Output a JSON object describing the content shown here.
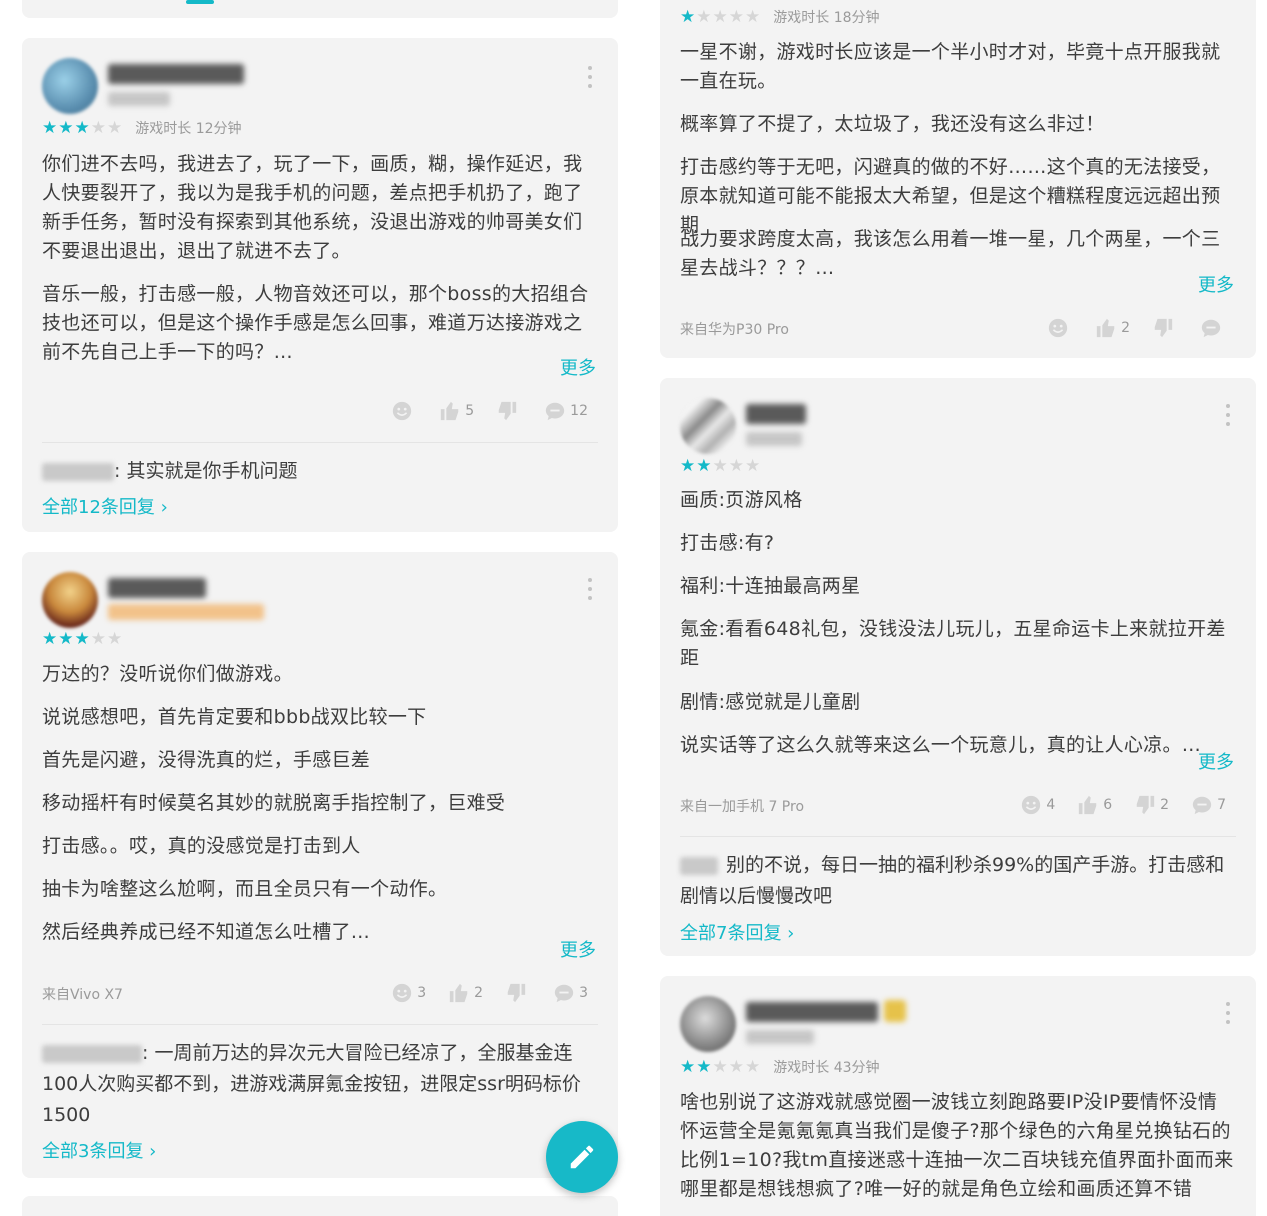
{
  "review1": {
    "rating": 3,
    "playtime": "游戏时长 12分钟",
    "paragraphs": [
      "你们进不去吗，我进去了，玩了一下，画质，糊，操作延迟，我人快要裂开了，我以为是我手机的问题，差点把手机扔了，跑了新手任务，暂时没有探索到其他系统，没退出游戏的帅哥美女们不要退出退出，退出了就进不去了。",
      "音乐一般，打击感一般，人物音效还可以，那个boss的大招组合技也还可以，但是这个操作手感是怎么回事，难道万达接游戏之前不先自己上手一下的吗？…"
    ],
    "more": "更多",
    "likes": "5",
    "comments": "12",
    "reply_text": ": 其实就是你手机问题",
    "all_replies": "全部12条回复 ›"
  },
  "review2": {
    "rating": 3,
    "paragraphs": [
      "万达的？没听说你们做游戏。",
      "说说感想吧，首先肯定要和bbb战双比较一下",
      "首先是闪避，没得洗真的烂，手感巨差",
      "移动摇杆有时候莫名其妙的就脱离手指控制了，巨难受",
      "打击感。。哎，真的没感觉是打击到人",
      "抽卡为啥整这么尬啊，而且全员只有一个动作。",
      "然后经典养成已经不知道怎么吐槽了…"
    ],
    "more": "更多",
    "device": "来自Vivo X7",
    "funny": "3",
    "likes": "2",
    "comments": "3",
    "reply_text": ": 一周前万达的异次元大冒险已经凉了，全服基金连100人次购买都不到，进游戏满屏氪金按钮，进限定ssr明码标价1500",
    "all_replies": "全部3条回复 ›"
  },
  "review3": {
    "rating": 1,
    "playtime": "游戏时长 18分钟",
    "paragraphs": [
      "一星不谢，游戏时长应该是一个半小时才对，毕竟十点开服我就一直在玩。",
      "概率算了不提了，太垃圾了，我还没有这么非过！",
      "打击感约等于无吧，闪避真的做的不好……这个真的无法接受，原本就知道可能不能报太大希望，但是这个糟糕程度远远超出预期",
      "战力要求跨度太高，我该怎么用着一堆一星，几个两星，一个三星去战斗？？？…"
    ],
    "more": "更多",
    "device": "来自华为P30 Pro",
    "likes": "2"
  },
  "review4": {
    "rating": 2,
    "paragraphs": [
      "画质:页游风格",
      "打击感:有?",
      "福利:十连抽最高两星",
      "氪金:看看648礼包，没钱没法儿玩儿，五星命运卡上来就拉开差距",
      "剧情:感觉就是儿童剧",
      "说实话等了这么久就等来这么一个玩意儿，真的让人心凉。…"
    ],
    "more": "更多",
    "device": "来自一加手机 7 Pro",
    "funny": "4",
    "likes": "6",
    "dislikes": "2",
    "comments": "7",
    "reply_text": "别的不说，每日一抽的福利秒杀99%的国产手游。打击感和剧情以后慢慢改吧",
    "all_replies": "全部7条回复 ›"
  },
  "review5": {
    "rating": 2,
    "playtime": "游戏时长 43分钟",
    "paragraphs": [
      "啥也别说了这游戏就感觉圈一波钱立刻跑路要IP没IP要情怀没情怀运营全是氪氪氪真当我们是傻子?那个绿色的六角星兑换钻石的比例1=10?我tm直接迷惑十连抽一次二百块钱充值界面扑面而来哪里都是想钱想疯了?唯一好的就是角色立绘和画质还算不错"
    ]
  },
  "colors": {
    "accent": "#14b9c8",
    "card": "#f3f3f3",
    "text": "#3d3d3d",
    "muted": "#9a9a9a"
  },
  "icons": [
    "more-vertical-icon",
    "star-icon",
    "funny-face-icon",
    "thumbs-up-icon",
    "thumbs-down-icon",
    "comment-bubble-icon",
    "edit-pencil-icon"
  ]
}
